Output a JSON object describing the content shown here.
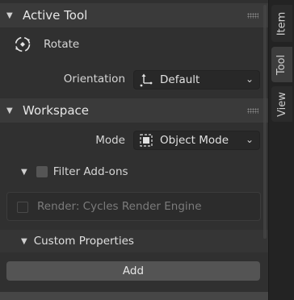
{
  "active_tool": {
    "section_title": "Active Tool",
    "tool_name": "Rotate",
    "orientation_label": "Orientation",
    "orientation_value": "Default"
  },
  "workspace": {
    "section_title": "Workspace",
    "mode_label": "Mode",
    "mode_value": "Object Mode",
    "filter_addons_label": "Filter Add-ons",
    "render_engine_label": "Render: Cycles Render Engine",
    "custom_properties_title": "Custom Properties",
    "add_label": "Add"
  },
  "side_tabs": [
    "Item",
    "Tool",
    "View"
  ],
  "active_tab": "Tool",
  "colors": {
    "panel_bg": "#303030",
    "header_bg": "#3a3a3a",
    "button_bg": "#545454",
    "text": "#d6d6d6"
  },
  "icons": {
    "collapse": "triangle-down",
    "rotate_tool": "rotate-arrows",
    "orientation": "transform-gizmo",
    "object_mode": "square-object",
    "dropdown": "chevron-down"
  }
}
